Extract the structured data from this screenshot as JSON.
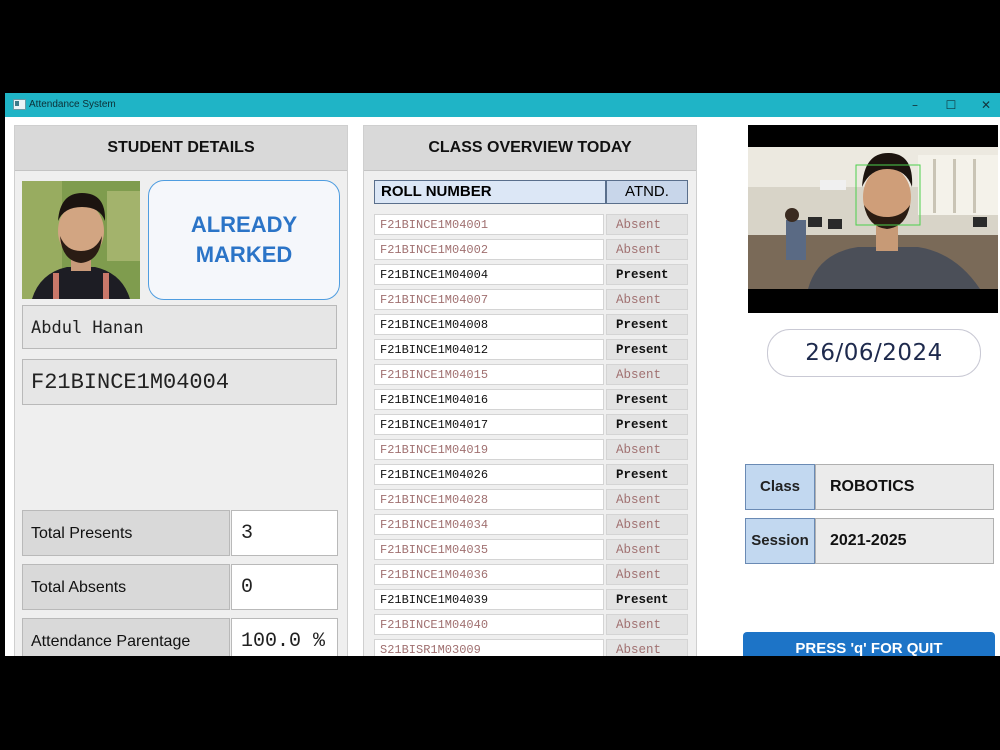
{
  "window": {
    "title": "Attendance System",
    "controls": {
      "minimize": "–",
      "maximize": "☐",
      "close": "✕"
    }
  },
  "student": {
    "header": "STUDENT DETAILS",
    "status": "ALREADY MARKED",
    "name": "Abdul  Hanan",
    "roll": "F21BINCE1M04004",
    "stats": [
      {
        "label": "Total Presents",
        "value": "3"
      },
      {
        "label": "Total Absents",
        "value": "0"
      },
      {
        "label": "Attendance Parentage",
        "value": "100.0 %"
      }
    ]
  },
  "overview": {
    "header": "CLASS OVERVIEW TODAY",
    "col_roll": "ROLL NUMBER",
    "col_atnd": "ATND.",
    "rows": [
      {
        "roll": "F21BINCE1M04001",
        "status": "Absent"
      },
      {
        "roll": "F21BINCE1M04002",
        "status": "Absent"
      },
      {
        "roll": "F21BINCE1M04004",
        "status": "Present"
      },
      {
        "roll": "F21BINCE1M04007",
        "status": "Absent"
      },
      {
        "roll": "F21BINCE1M04008",
        "status": "Present"
      },
      {
        "roll": "F21BINCE1M04012",
        "status": "Present"
      },
      {
        "roll": "F21BINCE1M04015",
        "status": "Absent"
      },
      {
        "roll": "F21BINCE1M04016",
        "status": "Present"
      },
      {
        "roll": "F21BINCE1M04017",
        "status": "Present"
      },
      {
        "roll": "F21BINCE1M04019",
        "status": "Absent"
      },
      {
        "roll": "F21BINCE1M04026",
        "status": "Present"
      },
      {
        "roll": "F21BINCE1M04028",
        "status": "Absent"
      },
      {
        "roll": "F21BINCE1M04034",
        "status": "Absent"
      },
      {
        "roll": "F21BINCE1M04035",
        "status": "Absent"
      },
      {
        "roll": "F21BINCE1M04036",
        "status": "Absent"
      },
      {
        "roll": "F21BINCE1M04039",
        "status": "Present"
      },
      {
        "roll": "F21BINCE1M04040",
        "status": "Absent"
      },
      {
        "roll": "S21BISR1M03009",
        "status": "Absent"
      }
    ]
  },
  "date": "26/06/2024",
  "class_info": {
    "label": "Class",
    "value": "ROBOTICS"
  },
  "session_info": {
    "label": "Session",
    "value": "2021-2025"
  },
  "quit_button": "PRESS 'q' FOR QUIT",
  "colors": {
    "titlebar": "#1fb4c6",
    "accent_blue": "#2b74c7",
    "button_blue": "#1d74c7",
    "absent_text": "#a07070"
  },
  "icons": {
    "app": "window-icon",
    "face_box": "face-detection-box"
  }
}
